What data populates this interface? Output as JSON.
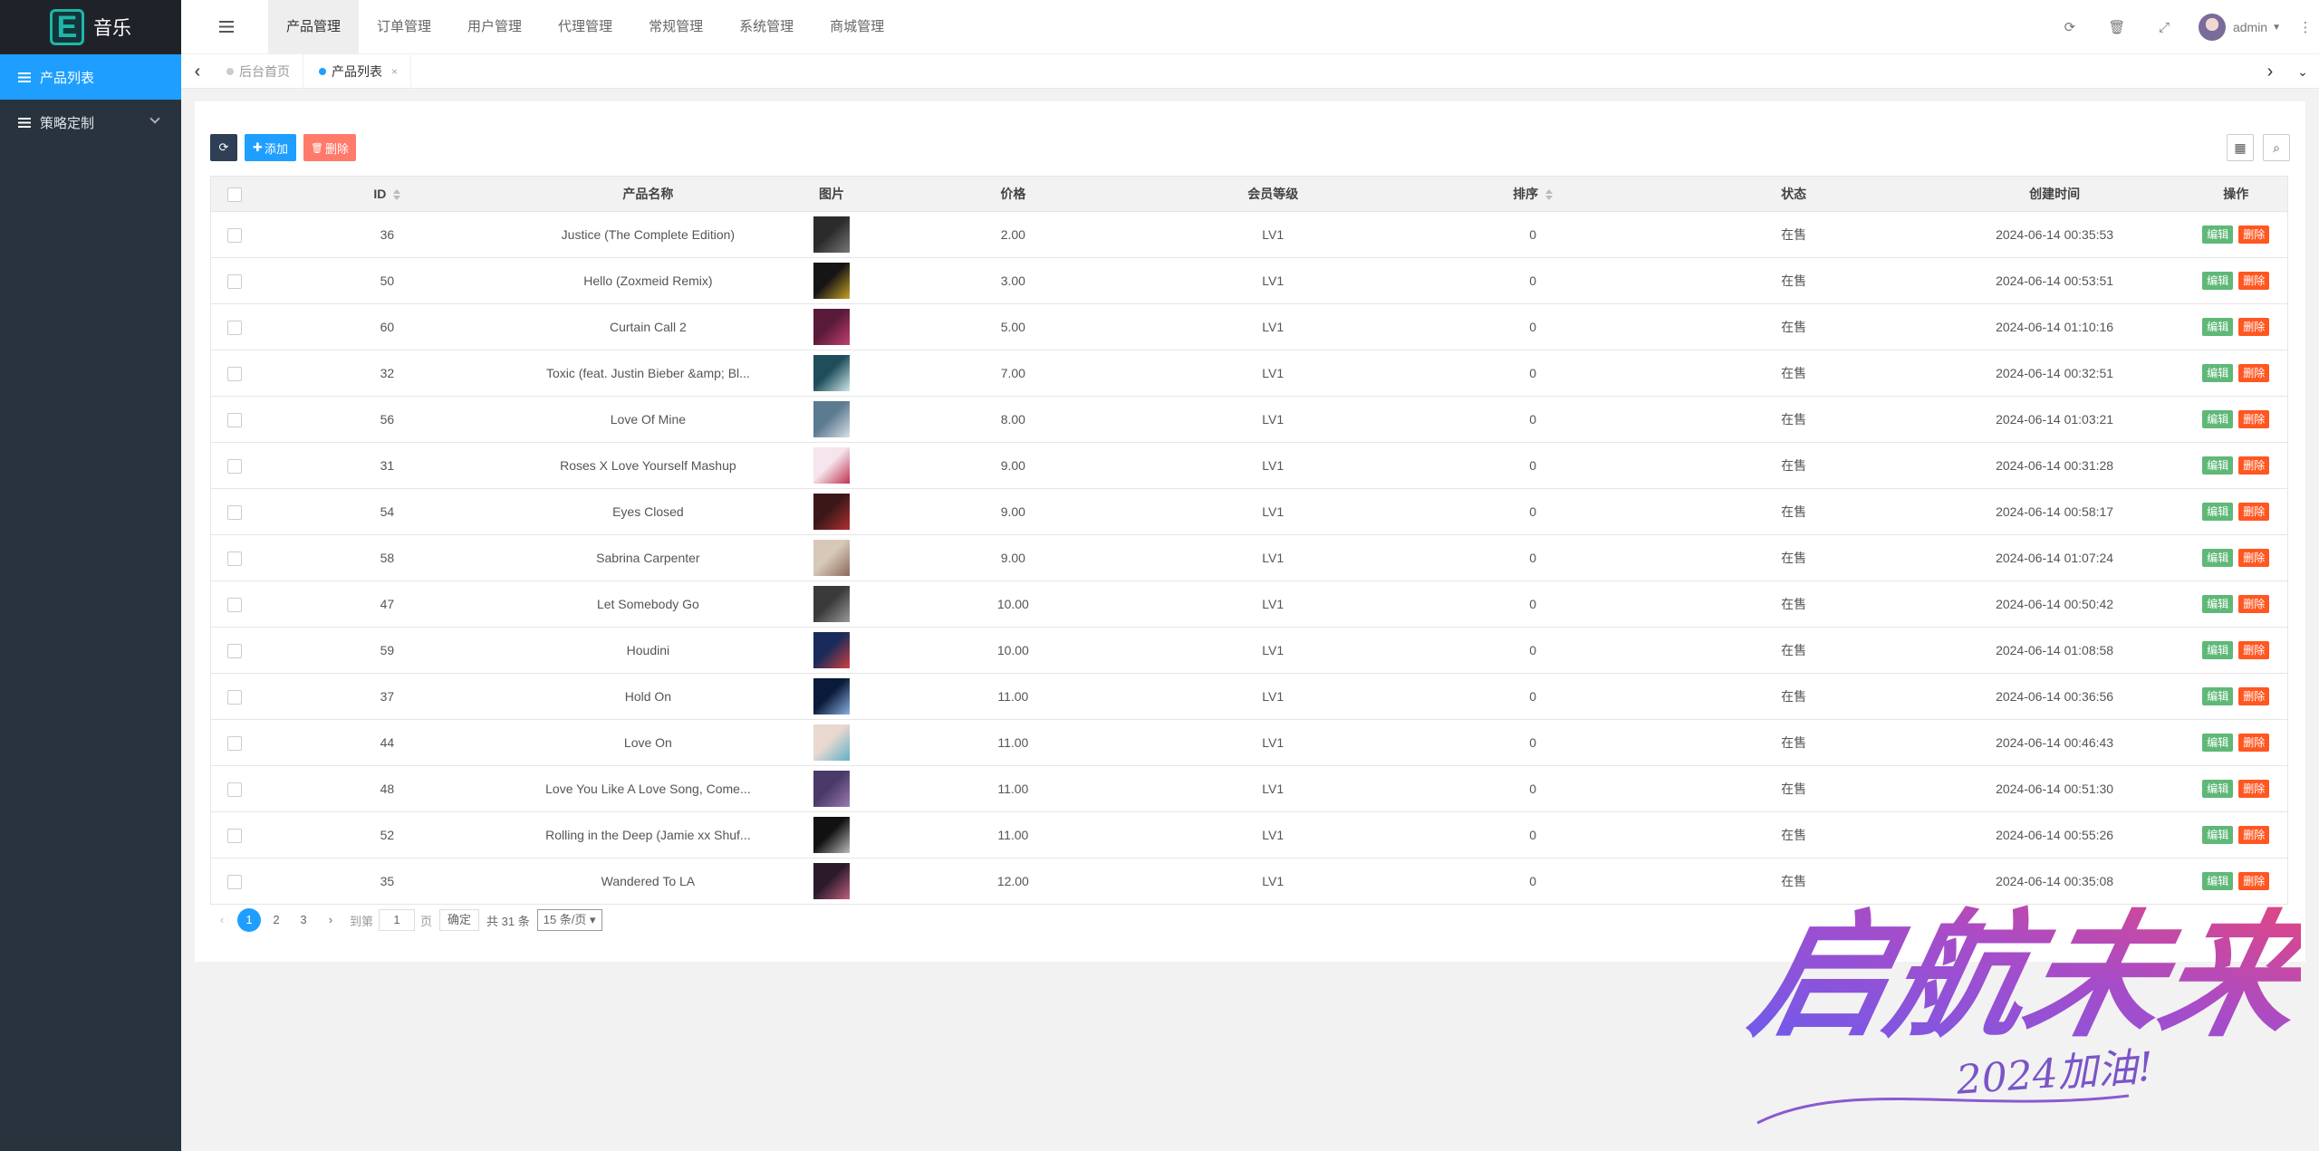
{
  "app": {
    "name": "音乐",
    "logo_letter": "E"
  },
  "sidebar": {
    "items": [
      {
        "label": "产品列表",
        "active": true
      },
      {
        "label": "策略定制",
        "active": false
      }
    ]
  },
  "header": {
    "menus": [
      "产品管理",
      "订单管理",
      "用户管理",
      "代理管理",
      "常规管理",
      "系统管理",
      "商城管理"
    ],
    "active_menu": "产品管理",
    "user": "admin"
  },
  "tabs": [
    {
      "label": "后台首页"
    },
    {
      "label": "产品列表",
      "close": "×"
    }
  ],
  "toolbar": {
    "add": "添加",
    "delete": "删除"
  },
  "table": {
    "headers": [
      "ID",
      "产品名称",
      "图片",
      "价格",
      "会员等级",
      "排序",
      "状态",
      "创建时间",
      "操作"
    ],
    "edit_label": "编辑",
    "delete_label": "删除",
    "rows": [
      {
        "id": "36",
        "name": "Justice (The Complete Edition)",
        "price": "2.00",
        "level": "LV1",
        "sort": "0",
        "status": "在售",
        "created": "2024-06-14 00:35:53",
        "thumb": [
          "#2b2b2b",
          "#777"
        ]
      },
      {
        "id": "50",
        "name": "Hello (Zoxmeid Remix)",
        "price": "3.00",
        "level": "LV1",
        "sort": "0",
        "status": "在售",
        "created": "2024-06-14 00:53:51",
        "thumb": [
          "#151515",
          "#c9a227"
        ]
      },
      {
        "id": "60",
        "name": "Curtain Call 2",
        "price": "5.00",
        "level": "LV1",
        "sort": "0",
        "status": "在售",
        "created": "2024-06-14 01:10:16",
        "thumb": [
          "#5a1a3a",
          "#c04070"
        ]
      },
      {
        "id": "32",
        "name": "Toxic (feat. Justin Bieber &amp; Bl...",
        "price": "7.00",
        "level": "LV1",
        "sort": "0",
        "status": "在售",
        "created": "2024-06-14 00:32:51",
        "thumb": [
          "#1f4e5a",
          "#cfe6ea"
        ]
      },
      {
        "id": "56",
        "name": "Love Of Mine",
        "price": "8.00",
        "level": "LV1",
        "sort": "0",
        "status": "在售",
        "created": "2024-06-14 01:03:21",
        "thumb": [
          "#5c7a90",
          "#d8e0e8"
        ]
      },
      {
        "id": "31",
        "name": "Roses X Love Yourself Mashup",
        "price": "9.00",
        "level": "LV1",
        "sort": "0",
        "status": "在售",
        "created": "2024-06-14 00:31:28",
        "thumb": [
          "#f4e6ec",
          "#c03050"
        ]
      },
      {
        "id": "54",
        "name": "Eyes Closed",
        "price": "9.00",
        "level": "LV1",
        "sort": "0",
        "status": "在售",
        "created": "2024-06-14 00:58:17",
        "thumb": [
          "#3a1818",
          "#b03030"
        ]
      },
      {
        "id": "58",
        "name": "Sabrina Carpenter",
        "price": "9.00",
        "level": "LV1",
        "sort": "0",
        "status": "在售",
        "created": "2024-06-14 01:07:24",
        "thumb": [
          "#d8c8b8",
          "#8a6a5a"
        ]
      },
      {
        "id": "47",
        "name": "Let Somebody Go",
        "price": "10.00",
        "level": "LV1",
        "sort": "0",
        "status": "在售",
        "created": "2024-06-14 00:50:42",
        "thumb": [
          "#3a3a3a",
          "#999"
        ]
      },
      {
        "id": "59",
        "name": "Houdini",
        "price": "10.00",
        "level": "LV1",
        "sort": "0",
        "status": "在售",
        "created": "2024-06-14 01:08:58",
        "thumb": [
          "#1a2a5a",
          "#d04040"
        ]
      },
      {
        "id": "37",
        "name": "Hold On",
        "price": "11.00",
        "level": "LV1",
        "sort": "0",
        "status": "在售",
        "created": "2024-06-14 00:36:56",
        "thumb": [
          "#0a1a3a",
          "#8ab0e0"
        ]
      },
      {
        "id": "44",
        "name": "Love On",
        "price": "11.00",
        "level": "LV1",
        "sort": "0",
        "status": "在售",
        "created": "2024-06-14 00:46:43",
        "thumb": [
          "#e8d8d0",
          "#60b0c8"
        ]
      },
      {
        "id": "48",
        "name": "Love You Like A Love Song, Come...",
        "price": "11.00",
        "level": "LV1",
        "sort": "0",
        "status": "在售",
        "created": "2024-06-14 00:51:30",
        "thumb": [
          "#4a3a6a",
          "#9a7ab0"
        ]
      },
      {
        "id": "52",
        "name": "Rolling in the Deep (Jamie xx Shuf...",
        "price": "11.00",
        "level": "LV1",
        "sort": "0",
        "status": "在售",
        "created": "2024-06-14 00:55:26",
        "thumb": [
          "#111",
          "#bbb"
        ]
      },
      {
        "id": "35",
        "name": "Wandered To LA",
        "price": "12.00",
        "level": "LV1",
        "sort": "0",
        "status": "在售",
        "created": "2024-06-14 00:35:08",
        "thumb": [
          "#2a1a2a",
          "#c06080"
        ]
      }
    ]
  },
  "pagination": {
    "pages": [
      "1",
      "2",
      "3"
    ],
    "current": "1",
    "goto": "到第",
    "input": "1",
    "page_unit": "页",
    "confirm": "确定",
    "total": "共 31 条",
    "per_page": "15 条/页"
  },
  "watermark": {
    "main": "启航未来",
    "sub": "2024加油!"
  },
  "colors": {
    "sidebar": "#28333e",
    "active": "#1e9fff",
    "edit": "#5fb878",
    "delete": "#ff5722",
    "refresh": "#2f4056"
  }
}
